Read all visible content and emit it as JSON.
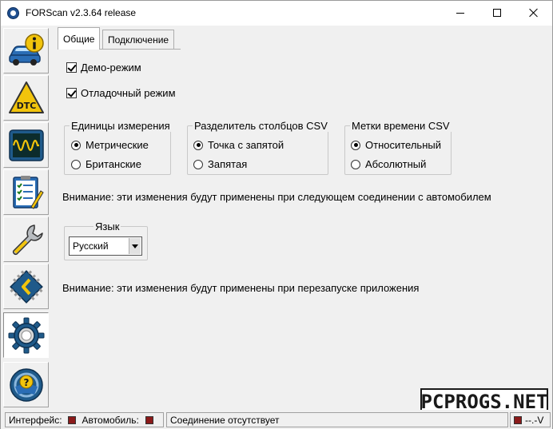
{
  "window": {
    "title": "FORScan v2.3.64 release"
  },
  "sidebar": {
    "items": [
      {
        "icon": "car-info-icon"
      },
      {
        "icon": "dtc-icon"
      },
      {
        "icon": "oscilloscope-icon"
      },
      {
        "icon": "checklist-icon"
      },
      {
        "icon": "wrench-icon"
      },
      {
        "icon": "chip-icon"
      },
      {
        "icon": "settings-gear-icon",
        "active": true
      },
      {
        "icon": "help-icon"
      }
    ]
  },
  "tabs": [
    {
      "label": "Общие",
      "active": true
    },
    {
      "label": "Подключение",
      "active": false
    }
  ],
  "general": {
    "demo_mode": {
      "label": "Демо-режим",
      "checked": true
    },
    "debug_mode": {
      "label": "Отладочный режим",
      "checked": true
    },
    "units": {
      "title": "Единицы измерения",
      "options": [
        {
          "label": "Метрические",
          "selected": true
        },
        {
          "label": "Британские",
          "selected": false
        }
      ]
    },
    "csv_separator": {
      "title": "Разделитель столбцов CSV",
      "options": [
        {
          "label": "Точка с запятой",
          "selected": true
        },
        {
          "label": "Запятая",
          "selected": false
        }
      ]
    },
    "csv_timestamps": {
      "title": "Метки времени CSV",
      "options": [
        {
          "label": "Относительный",
          "selected": true
        },
        {
          "label": "Абсолютный",
          "selected": false
        }
      ]
    },
    "note_connection": "Внимание: эти изменения будут применены при следующем соединении с автомобилем",
    "language": {
      "title": "Язык",
      "value": "Русский"
    },
    "note_restart": "Внимание: эти изменения будут применены при перезапуске приложения"
  },
  "watermark": "PCPROGS.NET",
  "statusbar": {
    "interface_label": "Интерфейс:",
    "vehicle_label": "Автомобиль:",
    "connection_status": "Соединение отсутствует",
    "voltage": "--.-V",
    "led_color": "#8b1a1a"
  },
  "colors": {
    "window_bg": "#f0f0f0",
    "icon_blue": "#1f4f8f",
    "icon_yellow": "#f2c40c"
  }
}
